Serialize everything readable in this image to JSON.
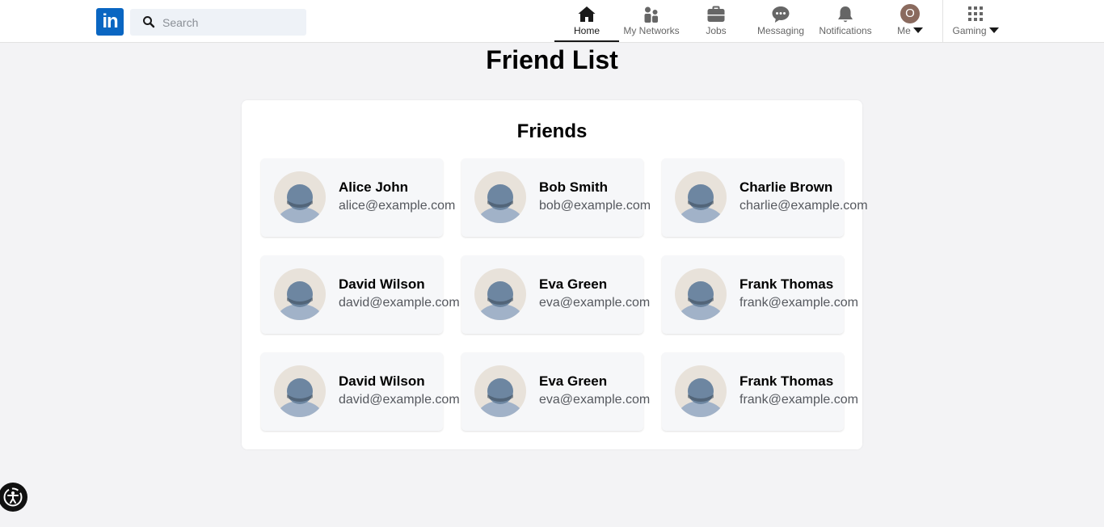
{
  "brand": {
    "logo_text": "in"
  },
  "search": {
    "placeholder": "Search",
    "value": ""
  },
  "nav": {
    "home": "Home",
    "networks": "My Networks",
    "jobs": "Jobs",
    "messaging": "Messaging",
    "notifications": "Notifications",
    "me": "Me",
    "me_initial": "O",
    "gaming": "Gaming"
  },
  "page": {
    "title": "Friend List"
  },
  "friends_panel": {
    "title": "Friends",
    "friends": [
      {
        "name": "Alice John",
        "email": "alice@example.com"
      },
      {
        "name": "Bob Smith",
        "email": "bob@example.com"
      },
      {
        "name": "Charlie Brown",
        "email": "charlie@example.com"
      },
      {
        "name": "David Wilson",
        "email": "david@example.com"
      },
      {
        "name": "Eva Green",
        "email": "eva@example.com"
      },
      {
        "name": "Frank Thomas",
        "email": "frank@example.com"
      },
      {
        "name": "David Wilson",
        "email": "david@example.com"
      },
      {
        "name": "Eva Green",
        "email": "eva@example.com"
      },
      {
        "name": "Frank Thomas",
        "email": "frank@example.com"
      }
    ]
  },
  "colors": {
    "brand": "#0a66c2",
    "avatar_bg": "#e8e2da",
    "avatar_fg": "#6d86a1"
  }
}
